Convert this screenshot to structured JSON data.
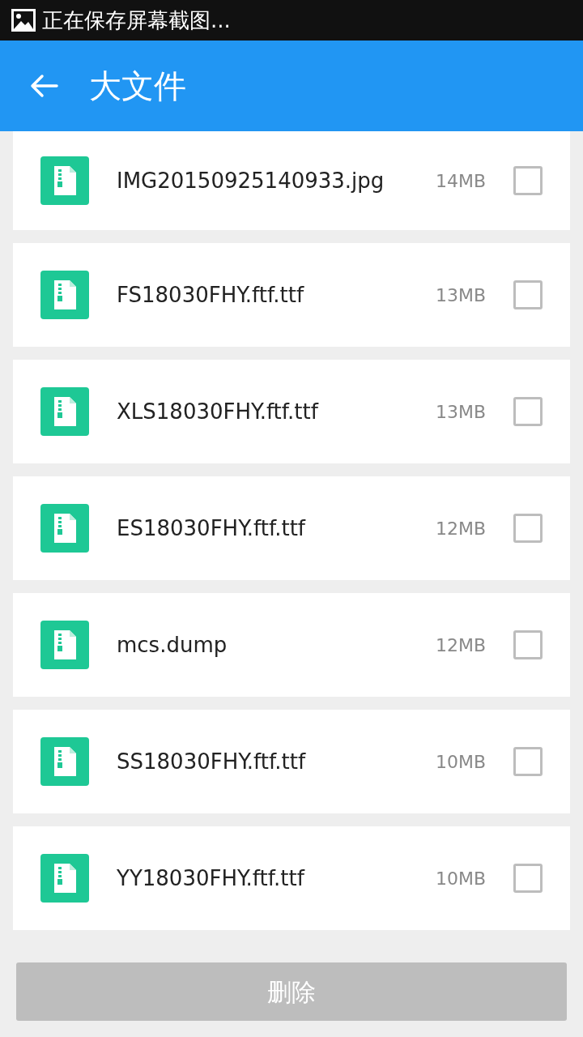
{
  "status_bar": {
    "notification": "正在保存屏幕截图..."
  },
  "app_bar": {
    "title": "大文件"
  },
  "files": [
    {
      "name": "IMG20150925140933.jpg",
      "size": "14MB",
      "checked": false
    },
    {
      "name": "FS18030FHY.ftf.ttf",
      "size": "13MB",
      "checked": false
    },
    {
      "name": "XLS18030FHY.ftf.ttf",
      "size": "13MB",
      "checked": false
    },
    {
      "name": "ES18030FHY.ftf.ttf",
      "size": "12MB",
      "checked": false
    },
    {
      "name": "mcs.dump",
      "size": "12MB",
      "checked": false
    },
    {
      "name": "SS18030FHY.ftf.ttf",
      "size": "10MB",
      "checked": false
    },
    {
      "name": "YY18030FHY.ftf.ttf",
      "size": "10MB",
      "checked": false
    }
  ],
  "delete_button": {
    "label": "删除",
    "disabled": true
  }
}
